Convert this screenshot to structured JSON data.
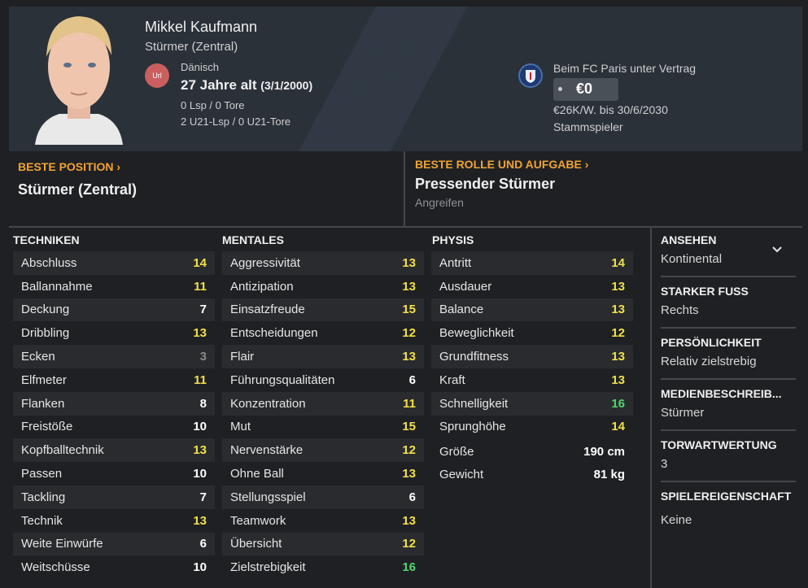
{
  "player": {
    "name": "Mikkel Kaufmann",
    "position": "Stürmer (Zentral)",
    "flag_text": "Url",
    "nationality": "Dänisch",
    "age": "27 Jahre alt",
    "dob": "(3/1/2000)",
    "caps": "0 Lsp / 0 Tore",
    "u21_caps": "2 U21-Lsp / 0 U21-Tore"
  },
  "contract": {
    "club_text": "Beim FC Paris unter Vertrag",
    "value": "€0",
    "wage": "€26K/W. bis 30/6/2030",
    "status": "Stammspieler"
  },
  "best_position": {
    "label": "BESTE POSITION",
    "value": "Stürmer (Zentral)"
  },
  "best_role": {
    "label": "BESTE ROLLE UND AUFGABE",
    "value": "Pressender Stürmer",
    "duty": "Angreifen"
  },
  "columns": {
    "technical": "TECHNIKEN",
    "mental": "MENTALES",
    "physical": "PHYSIS"
  },
  "technical": [
    {
      "name": "Abschluss",
      "value": "14"
    },
    {
      "name": "Ballannahme",
      "value": "11"
    },
    {
      "name": "Deckung",
      "value": "7"
    },
    {
      "name": "Dribbling",
      "value": "13"
    },
    {
      "name": "Ecken",
      "value": "3"
    },
    {
      "name": "Elfmeter",
      "value": "11"
    },
    {
      "name": "Flanken",
      "value": "8"
    },
    {
      "name": "Freistöße",
      "value": "10"
    },
    {
      "name": "Kopfballtechnik",
      "value": "13"
    },
    {
      "name": "Passen",
      "value": "10"
    },
    {
      "name": "Tackling",
      "value": "7"
    },
    {
      "name": "Technik",
      "value": "13"
    },
    {
      "name": "Weite Einwürfe",
      "value": "6"
    },
    {
      "name": "Weitschüsse",
      "value": "10"
    }
  ],
  "mental": [
    {
      "name": "Aggressivität",
      "value": "13"
    },
    {
      "name": "Antizipation",
      "value": "13"
    },
    {
      "name": "Einsatzfreude",
      "value": "15"
    },
    {
      "name": "Entscheidungen",
      "value": "12"
    },
    {
      "name": "Flair",
      "value": "13"
    },
    {
      "name": "Führungsqualitäten",
      "value": "6"
    },
    {
      "name": "Konzentration",
      "value": "11"
    },
    {
      "name": "Mut",
      "value": "15"
    },
    {
      "name": "Nervenstärke",
      "value": "12"
    },
    {
      "name": "Ohne Ball",
      "value": "13"
    },
    {
      "name": "Stellungsspiel",
      "value": "6"
    },
    {
      "name": "Teamwork",
      "value": "13"
    },
    {
      "name": "Übersicht",
      "value": "12"
    },
    {
      "name": "Zielstrebigkeit",
      "value": "16"
    }
  ],
  "physical": [
    {
      "name": "Antritt",
      "value": "14"
    },
    {
      "name": "Ausdauer",
      "value": "13"
    },
    {
      "name": "Balance",
      "value": "13"
    },
    {
      "name": "Beweglichkeit",
      "value": "12"
    },
    {
      "name": "Grundfitness",
      "value": "13"
    },
    {
      "name": "Kraft",
      "value": "13"
    },
    {
      "name": "Schnelligkeit",
      "value": "16"
    },
    {
      "name": "Sprunghöhe",
      "value": "14"
    }
  ],
  "physical_extra": {
    "height_label": "Größe",
    "height": "190 cm",
    "weight_label": "Gewicht",
    "weight": "81 kg"
  },
  "sidebar": {
    "reputation": {
      "label": "ANSEHEN",
      "value": "Kontinental"
    },
    "foot": {
      "label": "STARKER FUSS",
      "value": "Rechts"
    },
    "personality": {
      "label": "PERSÖNLICHKEIT",
      "value": "Relativ zielstrebig"
    },
    "media": {
      "label": "MEDIENBESCHREIB...",
      "value": "Stürmer"
    },
    "gk_rating": {
      "label": "TORWARTWERTUNG",
      "value": "3"
    },
    "traits": {
      "label": "SPIELEREIGENSCHAFT",
      "value": "Keine"
    }
  },
  "colors": {
    "accent_orange": "#f0a334",
    "value_yellow": "#f2e14a",
    "value_green": "#4fd86c",
    "value_grey": "#8a8a8a"
  }
}
